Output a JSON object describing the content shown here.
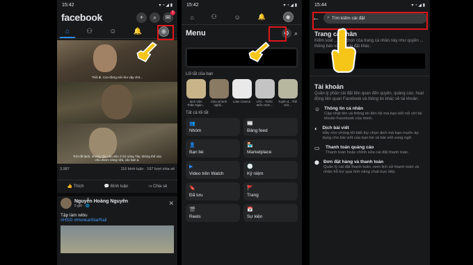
{
  "phone1": {
    "time": "15:42",
    "status_icons": "▾ ◔ ◢ ▮",
    "logo": "facebook",
    "header_icons": {
      "add": "+",
      "search": "⌕",
      "messenger": "✉"
    },
    "messenger_badge": "1",
    "nav_icons": [
      "⌂",
      "⚇",
      "☺",
      "🔔",
      "◉"
    ],
    "subtitles": [
      "Thôi đi. Con đừng nói như vậy chứ...",
      "",
      "Trời rất lạnh, nhưng cậu cho việc ở bờ sông Tây, không thể nào chịu được nóng nữa, các bạn ạ."
    ],
    "reaction_count": "3,987",
    "comment_share": "116 bình luận · 167 lượt chia sẻ",
    "actions": [
      "👍 Thích",
      "💬 Bình luận",
      "↪ Chia sẻ"
    ],
    "post2": {
      "name": "Nguyễn Hoàng Nguyên",
      "time": "5 giờ · 🌐",
      "close": "✕",
      "text": "Tập làm wibu",
      "tags": "#HSG #HonkaiStarRail"
    }
  },
  "phone2": {
    "time": "15:42",
    "status_icons": "▾ ◔ ◢ ▮",
    "top_icons": [
      "⌂",
      "⚇",
      "☺",
      "🔔",
      "◉"
    ],
    "title": "Menu",
    "gear": "⚙",
    "search": "⌕",
    "shortcuts_label": "Lối tắt của bạn",
    "shortcuts": [
      {
        "label": "Sinh Viên Thăm Ngàn...",
        "color": "#c9b48a"
      },
      {
        "label": "Chia sẻ kinh nghiệ...",
        "color": "#8a7a63"
      },
      {
        "label": "Lotte Cinema",
        "color": "#e9e9e9"
      },
      {
        "label": "UTC - THẮC MẮC HỌC...",
        "color": "#c4c4c4"
      },
      {
        "label": "Tuyển d... Thế Giớ...",
        "color": "#b7b7a0"
      }
    ],
    "all_shortcuts_label": "Tất cả lối tắt",
    "tiles": [
      {
        "icon": "👥",
        "label": "Nhóm",
        "color": "#2d88ff"
      },
      {
        "icon": "📰",
        "label": "Bảng feed",
        "color": "#2d88ff"
      },
      {
        "icon": "👤",
        "label": "Bạn bè",
        "color": "#2d88ff"
      },
      {
        "icon": "🏪",
        "label": "Marketplace",
        "color": "#2d88ff"
      },
      {
        "icon": "▶",
        "label": "Video trên Watch",
        "color": "#2d88ff"
      },
      {
        "icon": "🕓",
        "label": "Kỷ niệm",
        "color": "#2d88ff"
      },
      {
        "icon": "🔖",
        "label": "Đã lưu",
        "color": "#a855f7"
      },
      {
        "icon": "🚩",
        "label": "Trang",
        "color": "#f97316"
      },
      {
        "icon": "🎬",
        "label": "Reels",
        "color": "#ef4444"
      },
      {
        "icon": "📅",
        "label": "Sự kiện",
        "color": "#ef4444"
      }
    ]
  },
  "phone3": {
    "time": "15:44",
    "status_icons": "▾ ◔ ◢ ▮",
    "back": "←",
    "search_icon": "⌕",
    "search_placeholder": "Tìm kiếm cài đặt",
    "profile_heading": "Trang cá nhân",
    "profile_desc": "Kiểm soát ... lựa chọn của trang cá nhân này như quyền ... thông báo và các cài đặt khác.",
    "account_heading": "Tài khoản",
    "account_desc": "Quản lý phần cài đặt liên quan đến quyền, quảng cáo, hoạt động liên quan Facebook và thông tin khác về tài khoản.",
    "items": [
      {
        "icon": "☺",
        "title": "Thông tin cá nhân",
        "desc": "Cập nhật tên và thông tin liên hệ mà bạn kết nối với tài khoản Facebook của mình."
      },
      {
        "icon": "◐",
        "title": "Dịch bài viết",
        "desc": "Hãy cho chúng tôi biết tùy chọn dịch mà bạn muốn áp dụng cho bài viết của bạn bè và bài viết song ngữ."
      },
      {
        "icon": "▭",
        "title": "Thanh toán quảng cáo",
        "desc": "Thanh toán hoặc chỉnh sửa cài đặt thanh toán."
      },
      {
        "icon": "⬢",
        "title": "Đơn đặt hàng và thanh toán",
        "desc": "Quản lý cài đặt thanh toán, xem lịch sử thanh toán và nhận hỗ trợ qua tính năng chat trực tiếp."
      }
    ]
  }
}
